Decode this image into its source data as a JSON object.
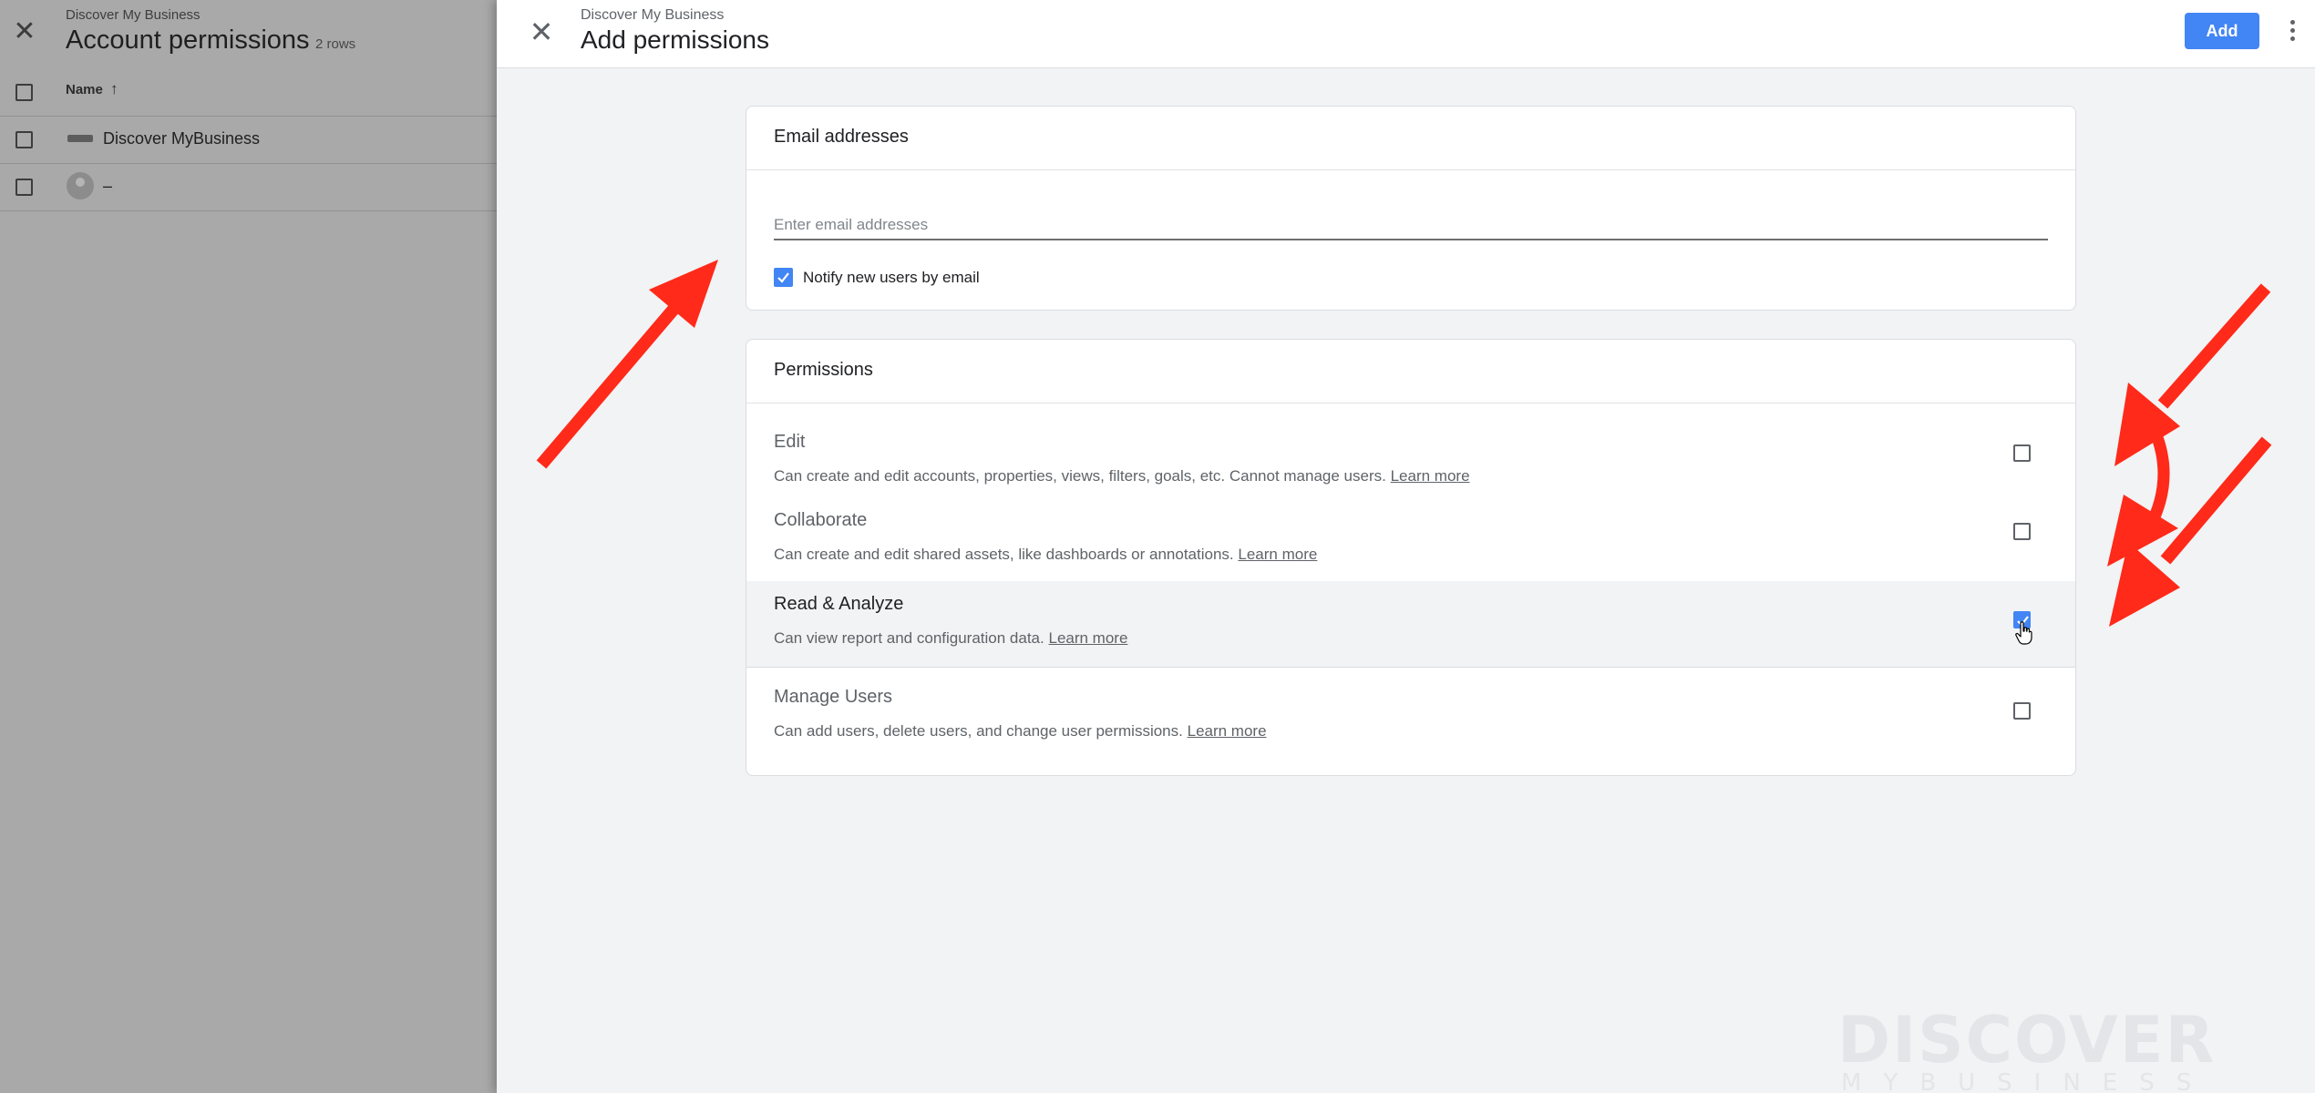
{
  "background": {
    "subtitle": "Discover My Business",
    "title": "Account permissions",
    "row_count": "2 rows",
    "column_name": "Name",
    "rows": [
      {
        "name": "Discover MyBusiness"
      },
      {
        "name": "–"
      }
    ]
  },
  "drawer": {
    "subtitle": "Discover My Business",
    "title": "Add permissions",
    "add_label": "Add",
    "email_section": {
      "title": "Email addresses",
      "placeholder": "Enter email addresses",
      "notify_label": "Notify new users by email",
      "notify_checked": true
    },
    "permissions_section": {
      "title": "Permissions",
      "items": [
        {
          "name": "Edit",
          "description": "Can create and edit accounts, properties, views, filters, goals, etc. Cannot manage users.",
          "link": "Learn more",
          "checked": false
        },
        {
          "name": "Collaborate",
          "description": "Can create and edit shared assets, like dashboards or annotations.",
          "link": "Learn more",
          "checked": false
        },
        {
          "name": "Read & Analyze",
          "description": "Can view report and configuration data.",
          "link": "Learn more",
          "checked": true
        },
        {
          "name": "Manage Users",
          "description": "Can add users, delete users, and change user permissions.",
          "link": "Learn more",
          "checked": false
        }
      ]
    }
  },
  "watermark": {
    "main": "DISCOVER",
    "sub": "MYBUSINESS"
  },
  "colors": {
    "accent": "#4285f4",
    "annotation": "#ff2a1a"
  }
}
